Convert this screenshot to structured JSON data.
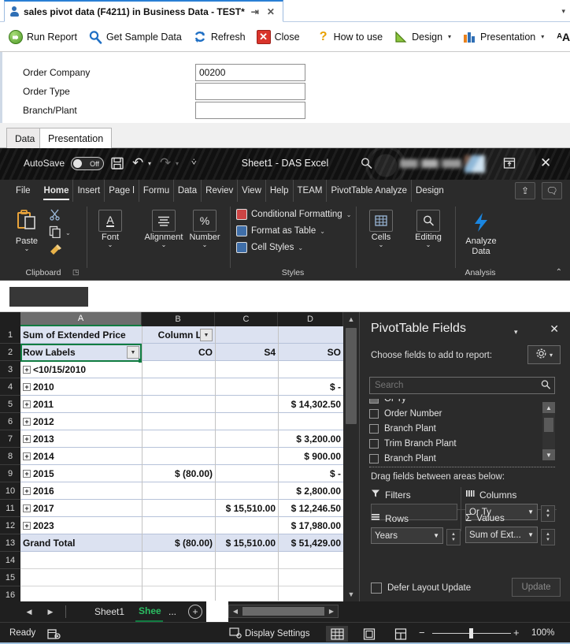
{
  "host": {
    "tab_title": "sales pivot data (F4211) in Business Data - TEST*",
    "pin_glyph": "⇥",
    "close_glyph": "✕",
    "strip_caret": "▾",
    "toolbar": [
      {
        "label": "Run Report",
        "icon": "run-report-icon"
      },
      {
        "label": "Get Sample Data",
        "icon": "magnifier-icon"
      },
      {
        "label": "Refresh",
        "icon": "refresh-icon"
      },
      {
        "label": "Close",
        "icon": "close-x-icon"
      },
      {
        "label": "How to use",
        "icon": "question-mark-icon"
      },
      {
        "label": "Design",
        "icon": "design-triangle-icon",
        "caret": "▾"
      },
      {
        "label": "Presentation",
        "icon": "bar-chart-icon",
        "caret": "▾"
      },
      {
        "label": "",
        "icon": "font-a-icon",
        "caret": "▾"
      }
    ],
    "form": {
      "fields": [
        {
          "label": "Order Company",
          "value": "00200"
        },
        {
          "label": "Order Type",
          "value": ""
        },
        {
          "label": "Branch/Plant",
          "value": ""
        }
      ]
    },
    "tabs2": [
      {
        "label": "Data",
        "active": false
      },
      {
        "label": "Presentation",
        "active": true
      }
    ]
  },
  "excel": {
    "titlebar": {
      "autosave_label": "AutoSave",
      "autosave_state": "Off",
      "save_icon": "save-disk-icon",
      "undo_icon": "undo-icon",
      "redo_icon": "redo-icon",
      "customize_icon": "customize-qat-icon",
      "title": "Sheet1  -  DAS Excel",
      "search_icon": "search-icon",
      "ribbon_display_icon": "ribbon-display-options-icon",
      "close_icon": "window-close-icon"
    },
    "tabs": [
      {
        "label": "File",
        "active": false
      },
      {
        "label": "Home",
        "active": true
      },
      {
        "label": "Insert",
        "active": false
      },
      {
        "label": "Page l",
        "active": false
      },
      {
        "label": "Formu",
        "active": false
      },
      {
        "label": "Data",
        "active": false
      },
      {
        "label": "Reviev",
        "active": false
      },
      {
        "label": "View",
        "active": false
      },
      {
        "label": "Help",
        "active": false
      },
      {
        "label": "TEAM",
        "active": false
      },
      {
        "label": "PivotTable Analyze",
        "active": false
      },
      {
        "label": "Design",
        "active": false
      }
    ],
    "tab_buttons": [
      {
        "icon": "share-icon"
      },
      {
        "icon": "comments-icon"
      }
    ],
    "ribbon": {
      "groups": [
        {
          "title": "Clipboard",
          "launcher": "dialog-launcher-icon"
        },
        {
          "title": "Styles"
        },
        {
          "title": "Analysis"
        }
      ],
      "paste": {
        "label": "Paste",
        "caret": "⌄",
        "icon": "paste-icon"
      },
      "clipboard_small": [
        {
          "label": "",
          "icon": "cut-scissors-icon"
        },
        {
          "label": "",
          "icon": "copy-icon",
          "caret": "⌄"
        },
        {
          "label": "",
          "icon": "format-painter-icon"
        }
      ],
      "big_buttons": [
        {
          "label": "Font",
          "caret": "⌄",
          "icon": "font-icon"
        },
        {
          "label": "Alignment",
          "caret": "⌄",
          "icon": "alignment-icon"
        },
        {
          "label": "Number",
          "caret": "⌄",
          "icon": "number-percent-icon"
        },
        {
          "label": "Cells",
          "caret": "⌄",
          "icon": "cells-icon"
        },
        {
          "label": "Editing",
          "caret": "⌄",
          "icon": "editing-magnifier-icon"
        }
      ],
      "styles": [
        {
          "label": "Conditional Formatting",
          "caret": "⌄",
          "icon": "conditional-formatting-icon"
        },
        {
          "label": "Format as Table",
          "caret": "⌄",
          "icon": "format-as-table-icon"
        },
        {
          "label": "Cell Styles",
          "caret": "⌄",
          "icon": "cell-styles-icon"
        }
      ],
      "analyze": {
        "line1": "Analyze",
        "line2": "Data",
        "icon": "analyze-data-bolt-icon"
      },
      "collapse": "⌃"
    },
    "grid": {
      "columns": [
        {
          "label": "A",
          "selected": true
        },
        {
          "label": "B",
          "selected": false
        },
        {
          "label": "C",
          "selected": false
        },
        {
          "label": "D",
          "selected": false
        }
      ],
      "rows": [
        {
          "n": "1",
          "kind": "hdrband",
          "a": "Sum of Extended Price",
          "b": "Column Lab",
          "c": "",
          "d": "",
          "bold": true,
          "filter_b": true
        },
        {
          "n": "2",
          "kind": "hdrband",
          "a": "Row Labels",
          "b": "CO",
          "c": "S4",
          "d": "SO",
          "bold": true,
          "filter_a": true
        },
        {
          "n": "3",
          "kind": "pivot",
          "a": "<10/15/2010",
          "b": "",
          "c": "",
          "d": "",
          "bold": true,
          "expand": true
        },
        {
          "n": "4",
          "kind": "pivot",
          "a": "2010",
          "b": "",
          "c": "",
          "d": "$             -",
          "bold": true,
          "expand": true
        },
        {
          "n": "5",
          "kind": "pivot",
          "a": "2011",
          "b": "",
          "c": "",
          "d": "$ 14,302.50",
          "bold": true,
          "expand": true
        },
        {
          "n": "6",
          "kind": "pivot",
          "a": "2012",
          "b": "",
          "c": "",
          "d": "",
          "bold": true,
          "expand": true
        },
        {
          "n": "7",
          "kind": "pivot",
          "a": "2013",
          "b": "",
          "c": "",
          "d": "$   3,200.00",
          "bold": true,
          "expand": true
        },
        {
          "n": "8",
          "kind": "pivot",
          "a": "2014",
          "b": "",
          "c": "",
          "d": "$      900.00",
          "bold": true,
          "expand": true
        },
        {
          "n": "9",
          "kind": "pivot",
          "a": "2015",
          "b": "$          (80.00)",
          "c": "",
          "d": "$             -",
          "bold": true,
          "expand": true
        },
        {
          "n": "10",
          "kind": "pivot",
          "a": "2016",
          "b": "",
          "c": "",
          "d": "$   2,800.00",
          "bold": true,
          "expand": true
        },
        {
          "n": "11",
          "kind": "pivot",
          "a": "2017",
          "b": "",
          "c": "$ 15,510.00",
          "d": "$ 12,246.50",
          "bold": true,
          "expand": true
        },
        {
          "n": "12",
          "kind": "pivot",
          "a": "2023",
          "b": "",
          "c": "",
          "d": "$ 17,980.00",
          "bold": true,
          "expand": true
        },
        {
          "n": "13",
          "kind": "hdrband",
          "a": "Grand Total",
          "b": "$          (80.00)",
          "c": "$ 15,510.00",
          "d": "$ 51,429.00",
          "bold": true
        },
        {
          "n": "14",
          "kind": "blank",
          "a": "",
          "b": "",
          "c": "",
          "d": ""
        },
        {
          "n": "15",
          "kind": "blank",
          "a": "",
          "b": "",
          "c": "",
          "d": ""
        },
        {
          "n": "16",
          "kind": "blank",
          "a": "",
          "b": "",
          "c": "",
          "d": ""
        },
        {
          "n": "17",
          "kind": "blank",
          "a": "",
          "b": "",
          "c": "",
          "d": ""
        }
      ]
    },
    "pivot_panel": {
      "title": "PivotTable Fields",
      "caret": "▾",
      "close": "✕",
      "subtitle": "Choose fields to add to report:",
      "gear_icon": "gear-icon",
      "gear_caret": "▾",
      "search_placeholder": "Search",
      "search_value": "",
      "search_icon": "search-icon",
      "fields": [
        {
          "label": "Or Ty",
          "checked": true,
          "clipped": true
        },
        {
          "label": "Order Number",
          "checked": false
        },
        {
          "label": "Branch Plant",
          "checked": false
        },
        {
          "label": "Trim Branch Plant",
          "checked": false
        },
        {
          "label": "Branch Plant",
          "checked": false,
          "clipped": true
        }
      ],
      "drag_label": "Drag fields between areas below:",
      "areas": [
        {
          "name": "Filters",
          "icon": "filter-funnel-icon",
          "pill": null
        },
        {
          "name": "Columns",
          "icon": "columns-icon",
          "pill": "Or Ty"
        },
        {
          "name": "Rows",
          "icon": "rows-icon",
          "pill": "Years"
        },
        {
          "name": "Values",
          "icon": "sigma-icon",
          "pill": "Sum of Ext..."
        }
      ],
      "defer_label": "Defer Layout Update",
      "defer_checked": false,
      "update_label": "Update"
    },
    "sheetbar": {
      "prev": "◀",
      "next": "▶",
      "tabs": [
        {
          "label": "Sheet1",
          "active": false
        },
        {
          "label": "Shee",
          "active": true
        },
        {
          "label": "...",
          "active": false
        }
      ],
      "add": "+",
      "hscroll_left": "◀",
      "hscroll_right": "▶"
    },
    "statusbar": {
      "status": "Ready",
      "record_icon": "macro-record-icon",
      "display_settings": "Display Settings",
      "display_settings_icon": "display-settings-icon",
      "views": [
        {
          "icon": "normal-view-icon",
          "active": true
        },
        {
          "icon": "page-layout-view-icon",
          "active": false
        },
        {
          "icon": "page-break-view-icon",
          "active": false
        }
      ],
      "zoom_out": "−",
      "zoom_in": "+",
      "zoom_level": "100%"
    }
  }
}
